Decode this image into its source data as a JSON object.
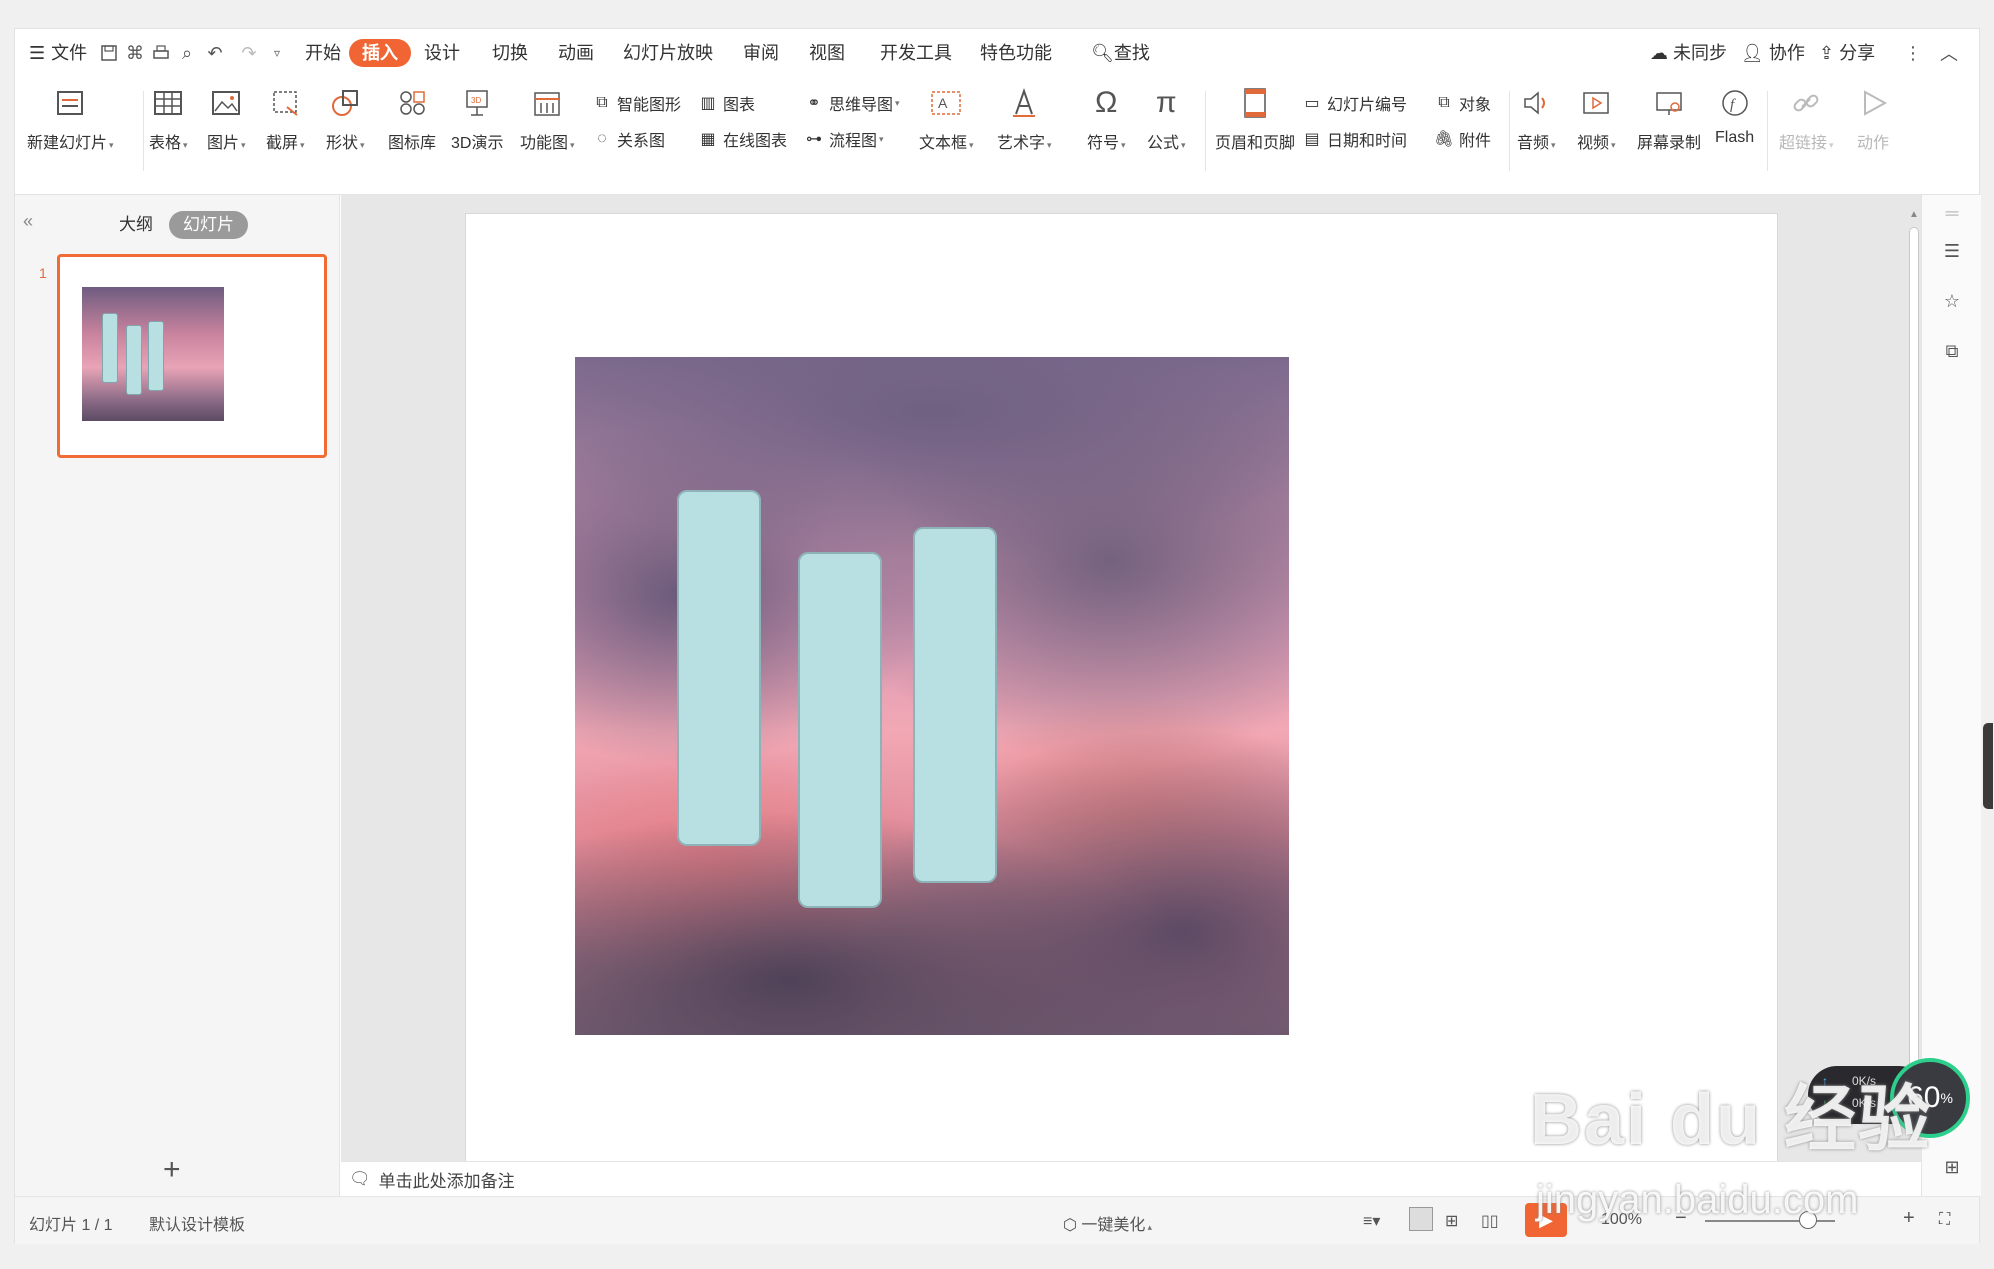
{
  "menu": {
    "file": "文件",
    "tabs": [
      "开始",
      "插入",
      "设计",
      "切换",
      "动画",
      "幻灯片放映",
      "审阅",
      "视图",
      "开发工具",
      "特色功能"
    ],
    "search": "查找",
    "sync": "未同步",
    "collab": "协作",
    "share": "分享"
  },
  "ribbon": {
    "new_slide": "新建幻灯片",
    "table": "表格",
    "picture": "图片",
    "screenshot": "截屏",
    "shape": "形状",
    "icon_lib": "图标库",
    "demo3d": "3D演示",
    "func_chart": "功能图",
    "smart_art": "智能图形",
    "chart": "图表",
    "relation": "关系图",
    "online_chart": "在线图表",
    "mindmap": "思维导图",
    "flowchart": "流程图",
    "textbox": "文本框",
    "wordart": "艺术字",
    "symbol": "符号",
    "formula": "公式",
    "header_footer": "页眉和页脚",
    "slide_number": "幻灯片编号",
    "object": "对象",
    "datetime": "日期和时间",
    "attachment": "附件",
    "audio": "音频",
    "video": "视频",
    "screen_record": "屏幕录制",
    "flash": "Flash",
    "hyperlink": "超链接",
    "action": "动作"
  },
  "panel": {
    "outline_tab": "大纲",
    "slides_tab": "幻灯片",
    "slide_index": "1",
    "add": "+"
  },
  "notes": {
    "placeholder": "单击此处添加备注"
  },
  "status": {
    "slide_count": "幻灯片 1 / 1",
    "template": "默认设计模板",
    "beautify": "一键美化",
    "zoom": "100%"
  },
  "speed": {
    "up": "0K/s",
    "down": "0K/s",
    "percent": "60",
    "unit": "%"
  },
  "watermark": {
    "line1": "Bai du 经验",
    "line2": "jingyan.baidu.com"
  }
}
